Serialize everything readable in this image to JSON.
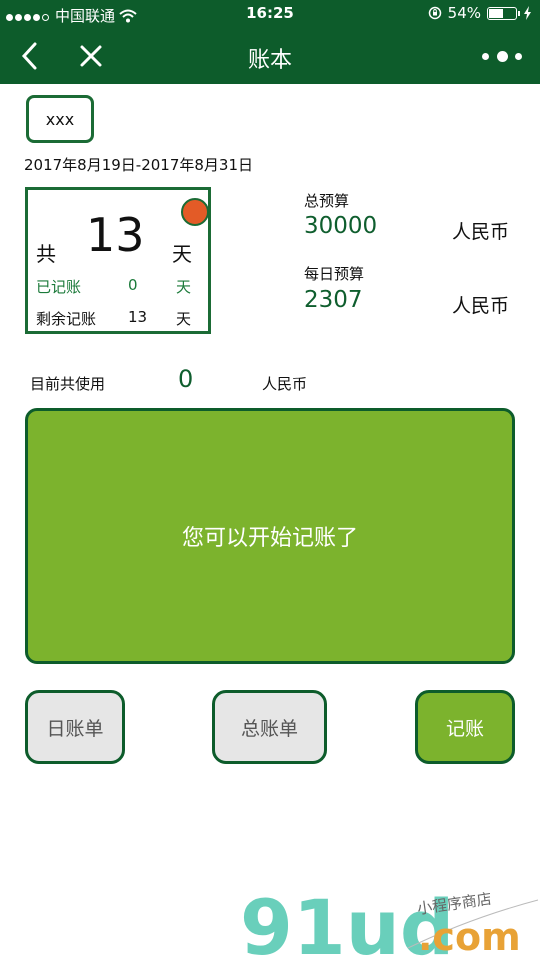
{
  "status": {
    "carrier": "中国联通",
    "time": "16:25",
    "battery_percent_label": "54%",
    "battery_level": 0.54
  },
  "nav": {
    "title": "账本"
  },
  "ledger": {
    "name": "xxx",
    "date_range": "2017年8月19日-2017年8月31日",
    "total_prefix": "共",
    "total_days": "13",
    "day_unit": "天",
    "recorded_label": "已记账",
    "recorded_days": "0",
    "remaining_label": "剩余记账",
    "remaining_days": "13",
    "status_color": "#e35b27"
  },
  "budget": {
    "total_label": "总预算",
    "total_value": "30000",
    "daily_label": "每日预算",
    "daily_value": "2307",
    "currency": "人民币"
  },
  "usage": {
    "label": "目前共使用",
    "value": "0",
    "currency": "人民币"
  },
  "message": "您可以开始记账了",
  "buttons": {
    "daily_bill": "日账单",
    "total_bill": "总账单",
    "record": "记账"
  },
  "watermark": {
    "brand": "91ud",
    "suffix": ".com",
    "tagline": "小程序商店"
  },
  "colors": {
    "nav_green": "#0d5c2b",
    "panel_green": "#7cb32d",
    "text_green": "#0f5e2e"
  }
}
